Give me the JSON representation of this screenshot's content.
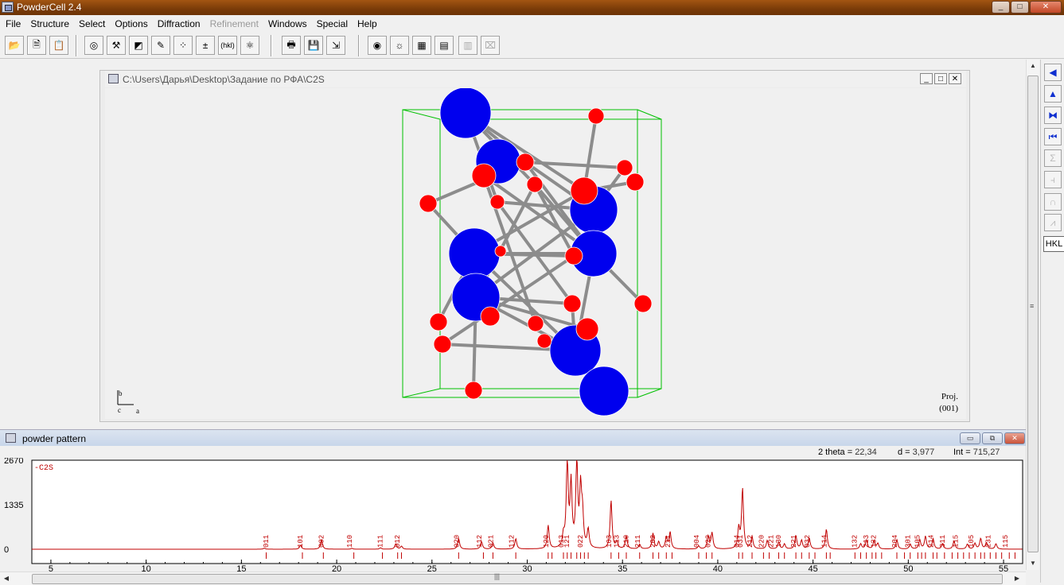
{
  "app": {
    "title": "PowderCell 2.4"
  },
  "window_controls": {
    "minimize": "_",
    "maximize": "□",
    "close": "✕"
  },
  "menu": [
    "File",
    "Structure",
    "Select",
    "Options",
    "Diffraction",
    "Refinement",
    "Windows",
    "Special",
    "Help"
  ],
  "menu_disabled": [
    "Refinement"
  ],
  "toolbar": {
    "buttons": [
      {
        "name": "open-file-icon",
        "glyph": "📂"
      },
      {
        "name": "save-structure-icon",
        "glyph": "🗎"
      },
      {
        "name": "clipboard-icon",
        "glyph": "📋"
      },
      {
        "name": "target-icon",
        "glyph": "◎"
      },
      {
        "name": "tools-icon",
        "glyph": "⚒"
      },
      {
        "name": "chart-edit-icon",
        "glyph": "◩"
      },
      {
        "name": "edit-icon",
        "glyph": "✎"
      },
      {
        "name": "atoms-icon",
        "glyph": "⁘"
      },
      {
        "name": "delta-x-icon",
        "glyph": "±"
      },
      {
        "name": "hkl-icon",
        "glyph": "(hkl)"
      },
      {
        "name": "molecule-icon",
        "glyph": "⚛"
      },
      {
        "name": "print-icon",
        "glyph": "🖶"
      },
      {
        "name": "save-pattern-icon",
        "glyph": "💾"
      },
      {
        "name": "export-icon",
        "glyph": "⇲"
      },
      {
        "name": "view-icon",
        "glyph": "◉"
      },
      {
        "name": "light-icon",
        "glyph": "☼"
      },
      {
        "name": "colors-icon",
        "glyph": "▦"
      },
      {
        "name": "grid-icon",
        "glyph": "▤"
      },
      {
        "name": "windows-icon",
        "glyph": "▥"
      },
      {
        "name": "info-icon",
        "glyph": "⌧"
      }
    ]
  },
  "right_toolbar": {
    "buttons": [
      {
        "name": "arrow-left-icon",
        "glyph": "◀"
      },
      {
        "name": "arrow-up-icon",
        "glyph": "▲"
      },
      {
        "name": "mirror-icon",
        "glyph": "⧓"
      },
      {
        "name": "first-icon",
        "glyph": "⏮"
      },
      {
        "name": "sum-icon",
        "glyph": "Σ"
      },
      {
        "name": "peaks-icon",
        "glyph": "⫞"
      },
      {
        "name": "curve-icon",
        "glyph": "∩"
      },
      {
        "name": "profile-icon",
        "glyph": "⩘"
      }
    ],
    "hkl_label": "HKL"
  },
  "structure_window": {
    "title": "C:\\Users\\Дарья\\Desktop\\Задание по РФА\\C2S",
    "axes": {
      "b": "b",
      "c": "c",
      "a": "a"
    },
    "proj_label": "Proj.",
    "proj_value": "(001)",
    "colors": {
      "ca": "#0000ee",
      "o": "#ff0000",
      "bond": "#8c8c8c",
      "cell": "#00c000"
    }
  },
  "powder_window": {
    "title": "powder pattern",
    "readout": {
      "two_theta_label": "2 theta =",
      "two_theta_value": "22,34",
      "d_label": "d =",
      "d_value": "3,977",
      "int_label": "Int =",
      "int_value": "715,27"
    }
  },
  "chart_data": {
    "type": "line",
    "series": [
      {
        "name": "C2S",
        "color": "#c00000"
      }
    ],
    "legend": "-C2S",
    "xlim": [
      4,
      56
    ],
    "xticks": [
      5,
      10,
      15,
      20,
      25,
      30,
      35,
      40,
      45,
      50,
      55
    ],
    "ylim": [
      0,
      2670
    ],
    "yticks": [
      "2670",
      "1335",
      "0"
    ],
    "peaks": [
      [
        16.2,
        30
      ],
      [
        18.1,
        120
      ],
      [
        19.2,
        280
      ],
      [
        20.8,
        25
      ],
      [
        22.3,
        40
      ],
      [
        23.1,
        160
      ],
      [
        23.4,
        90
      ],
      [
        26.4,
        320
      ],
      [
        27.6,
        230
      ],
      [
        28.2,
        180
      ],
      [
        29.4,
        310
      ],
      [
        31.1,
        700
      ],
      [
        31.9,
        350
      ],
      [
        32.1,
        2640
      ],
      [
        32.3,
        1900
      ],
      [
        32.6,
        2600
      ],
      [
        32.8,
        1700
      ],
      [
        32.9,
        950
      ],
      [
        33.2,
        550
      ],
      [
        34.4,
        1450
      ],
      [
        34.7,
        200
      ],
      [
        35.2,
        380
      ],
      [
        35.9,
        140
      ],
      [
        36.6,
        470
      ],
      [
        36.9,
        210
      ],
      [
        37.3,
        350
      ],
      [
        37.5,
        500
      ],
      [
        39.0,
        90
      ],
      [
        39.5,
        380
      ],
      [
        39.7,
        480
      ],
      [
        41.1,
        600
      ],
      [
        41.3,
        1800
      ],
      [
        41.8,
        360
      ],
      [
        42.6,
        260
      ],
      [
        43.2,
        200
      ],
      [
        43.5,
        150
      ],
      [
        44.1,
        400
      ],
      [
        44.4,
        260
      ],
      [
        44.8,
        330
      ],
      [
        45.7,
        600
      ],
      [
        47.5,
        160
      ],
      [
        47.8,
        270
      ],
      [
        48.2,
        230
      ],
      [
        48.4,
        170
      ],
      [
        49.4,
        280
      ],
      [
        50.1,
        150
      ],
      [
        50.6,
        280
      ],
      [
        50.9,
        380
      ],
      [
        51.3,
        310
      ],
      [
        51.8,
        160
      ],
      [
        52.4,
        250
      ],
      [
        53.1,
        150
      ],
      [
        53.5,
        170
      ],
      [
        53.8,
        320
      ],
      [
        54.1,
        190
      ],
      [
        54.6,
        160
      ]
    ],
    "hkl_labels": [
      [
        16.4,
        "011"
      ],
      [
        18.2,
        "101"
      ],
      [
        19.3,
        "002"
      ],
      [
        20.8,
        "110"
      ],
      [
        22.4,
        "111"
      ],
      [
        23.3,
        "012"
      ],
      [
        26.4,
        "020"
      ],
      [
        27.6,
        "112"
      ],
      [
        28.2,
        "021"
      ],
      [
        29.3,
        "112"
      ],
      [
        31.1,
        "120"
      ],
      [
        31.9,
        "013"
      ],
      [
        32.2,
        "121"
      ],
      [
        32.9,
        "022"
      ],
      [
        34.4,
        "103"
      ],
      [
        34.8,
        "113"
      ],
      [
        35.3,
        "210"
      ],
      [
        35.9,
        "211"
      ],
      [
        36.7,
        "202"
      ],
      [
        37.5,
        "211"
      ],
      [
        39.0,
        "004"
      ],
      [
        39.6,
        "022"
      ],
      [
        41.3,
        "031"
      ],
      [
        41.1,
        "014"
      ],
      [
        41.8,
        "212"
      ],
      [
        42.4,
        "220"
      ],
      [
        42.9,
        "221"
      ],
      [
        43.3,
        "130"
      ],
      [
        44.1,
        "221"
      ],
      [
        44.8,
        "032"
      ],
      [
        45.7,
        "114"
      ],
      [
        47.3,
        "132"
      ],
      [
        47.9,
        "213"
      ],
      [
        48.3,
        "132"
      ],
      [
        49.4,
        "204"
      ],
      [
        50.1,
        "301"
      ],
      [
        50.6,
        "105"
      ],
      [
        51.3,
        "214"
      ],
      [
        51.9,
        "311"
      ],
      [
        52.6,
        "115"
      ],
      [
        53.4,
        "105"
      ],
      [
        54.3,
        "231"
      ],
      [
        55.2,
        "115"
      ]
    ],
    "reflection_ticks": [
      16.3,
      18.2,
      19.3,
      20.9,
      22.4,
      23.2,
      23.4,
      26.4,
      27.7,
      28.2,
      29.4,
      31.1,
      31.3,
      31.9,
      32.1,
      32.3,
      32.6,
      32.8,
      33.0,
      33.2,
      34.4,
      34.8,
      35.2,
      35.9,
      36.6,
      36.9,
      37.3,
      37.6,
      39.0,
      39.4,
      39.7,
      41.1,
      41.3,
      41.8,
      42.4,
      42.7,
      43.2,
      43.5,
      44.1,
      44.4,
      44.8,
      45.1,
      45.7,
      45.9,
      47.2,
      47.5,
      47.8,
      48.1,
      48.3,
      48.6,
      49.4,
      49.8,
      50.1,
      50.5,
      50.7,
      50.9,
      51.3,
      51.5,
      51.9,
      52.3,
      52.6,
      52.9,
      53.2,
      53.5,
      53.8,
      54.0,
      54.3,
      54.6,
      54.9,
      55.3,
      55.6
    ]
  }
}
